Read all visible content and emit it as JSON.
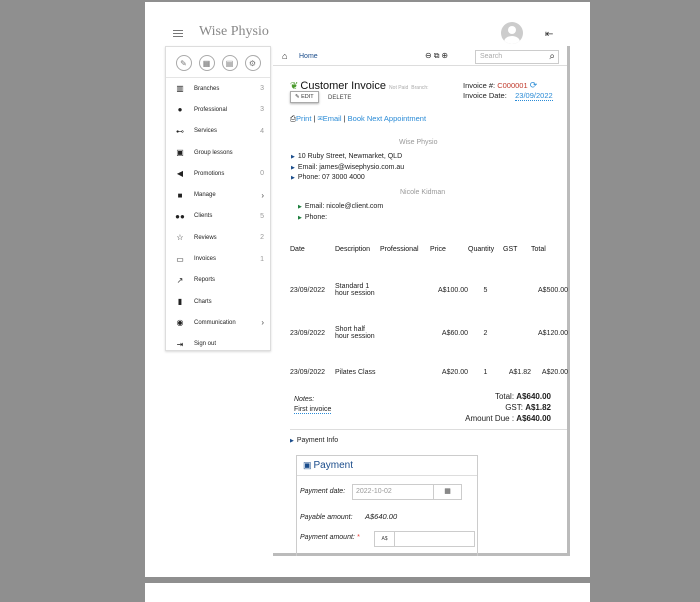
{
  "app": {
    "title": "Wise Physio"
  },
  "sidebar": {
    "quick_actions": [
      "edit-icon",
      "briefcase-icon",
      "calendar-icon",
      "settings-icon"
    ],
    "items": [
      {
        "icon": "building-icon",
        "label": "Branches",
        "count": "3"
      },
      {
        "icon": "person-icon",
        "label": "Professional",
        "count": "3"
      },
      {
        "icon": "handshake-icon",
        "label": "Services",
        "count": "4"
      },
      {
        "icon": "id-card-icon",
        "label": "Group lessons",
        "count": ""
      },
      {
        "icon": "megaphone-icon",
        "label": "Promotions",
        "count": "0"
      },
      {
        "icon": "briefcase-icon",
        "label": "Manage",
        "count": "",
        "arrow": "›"
      },
      {
        "icon": "users-icon",
        "label": "Clients",
        "count": "5"
      },
      {
        "icon": "star-icon",
        "label": "Reviews",
        "count": "2"
      },
      {
        "icon": "invoice-icon",
        "label": "Invoices",
        "count": "1"
      },
      {
        "icon": "line-chart-icon",
        "label": "Reports",
        "count": ""
      },
      {
        "icon": "bar-chart-icon",
        "label": "Charts",
        "count": ""
      },
      {
        "icon": "chat-icon",
        "label": "Communication",
        "count": "",
        "arrow": "›"
      },
      {
        "icon": "sign-out-icon",
        "label": "Sign out",
        "count": ""
      }
    ]
  },
  "breadcrumb": {
    "home": "Home"
  },
  "search": {
    "placeholder": "Search"
  },
  "invoice": {
    "title": "Customer Invoice",
    "status": "Not Paid",
    "branch_label": "Branch:",
    "edit_label": "EDIT",
    "delete_label": "DELETE",
    "number_label": "Invoice #:",
    "number": "C000001",
    "date_label": "Invoice Date:",
    "date": "23/09/2022",
    "actions": {
      "print": "Print",
      "email": "Email",
      "book": "Book Next Appointment"
    },
    "business": {
      "name": "Wise Physio",
      "address": "10 Ruby Street, Newmarket, QLD",
      "email": "Email: james@wisephysio.com.au",
      "phone": "Phone: 07 3000 4000"
    },
    "client": {
      "name": "Nicole Kidman",
      "email": "Email: nicole@client.com",
      "phone": "Phone:"
    },
    "table": {
      "headers": [
        "Date",
        "Description",
        "Professional",
        "Price",
        "Quantity",
        "GST",
        "Total"
      ],
      "rows": [
        {
          "date": "23/09/2022",
          "description": "Standard 1 hour session",
          "professional": "",
          "price": "A$100.00",
          "quantity": "5",
          "gst": "",
          "total": "A$500.00"
        },
        {
          "date": "23/09/2022",
          "description": "Short half hour session",
          "professional": "",
          "price": "A$60.00",
          "quantity": "2",
          "gst": "",
          "total": "A$120.00"
        },
        {
          "date": "23/09/2022",
          "description": "Pilates Class",
          "professional": "",
          "price": "A$20.00",
          "quantity": "1",
          "gst": "A$1.82",
          "total": "A$20.00"
        }
      ]
    },
    "notes_label": "Notes:",
    "notes": "First invoice",
    "totals": {
      "total_label": "Total:",
      "total": "A$640.00",
      "gst_label": "GST:",
      "gst": "A$1.82",
      "due_label": "Amount Due :",
      "due": "A$640.00"
    },
    "payment_info_label": "Payment Info"
  },
  "payment": {
    "title": "Payment",
    "date_label": "Payment date:",
    "date_placeholder": "2022-10-02",
    "payable_label": "Payable amount:",
    "payable": "A$640.00",
    "amount_label": "Payment amount:",
    "required": "*",
    "currency_prefix": "A$"
  },
  "colors": {
    "accent": "#2a8bd6",
    "invoice_number": "#c0392b",
    "brand_leaf": "#4a9a2c",
    "nav_link": "#1a4c8b"
  }
}
